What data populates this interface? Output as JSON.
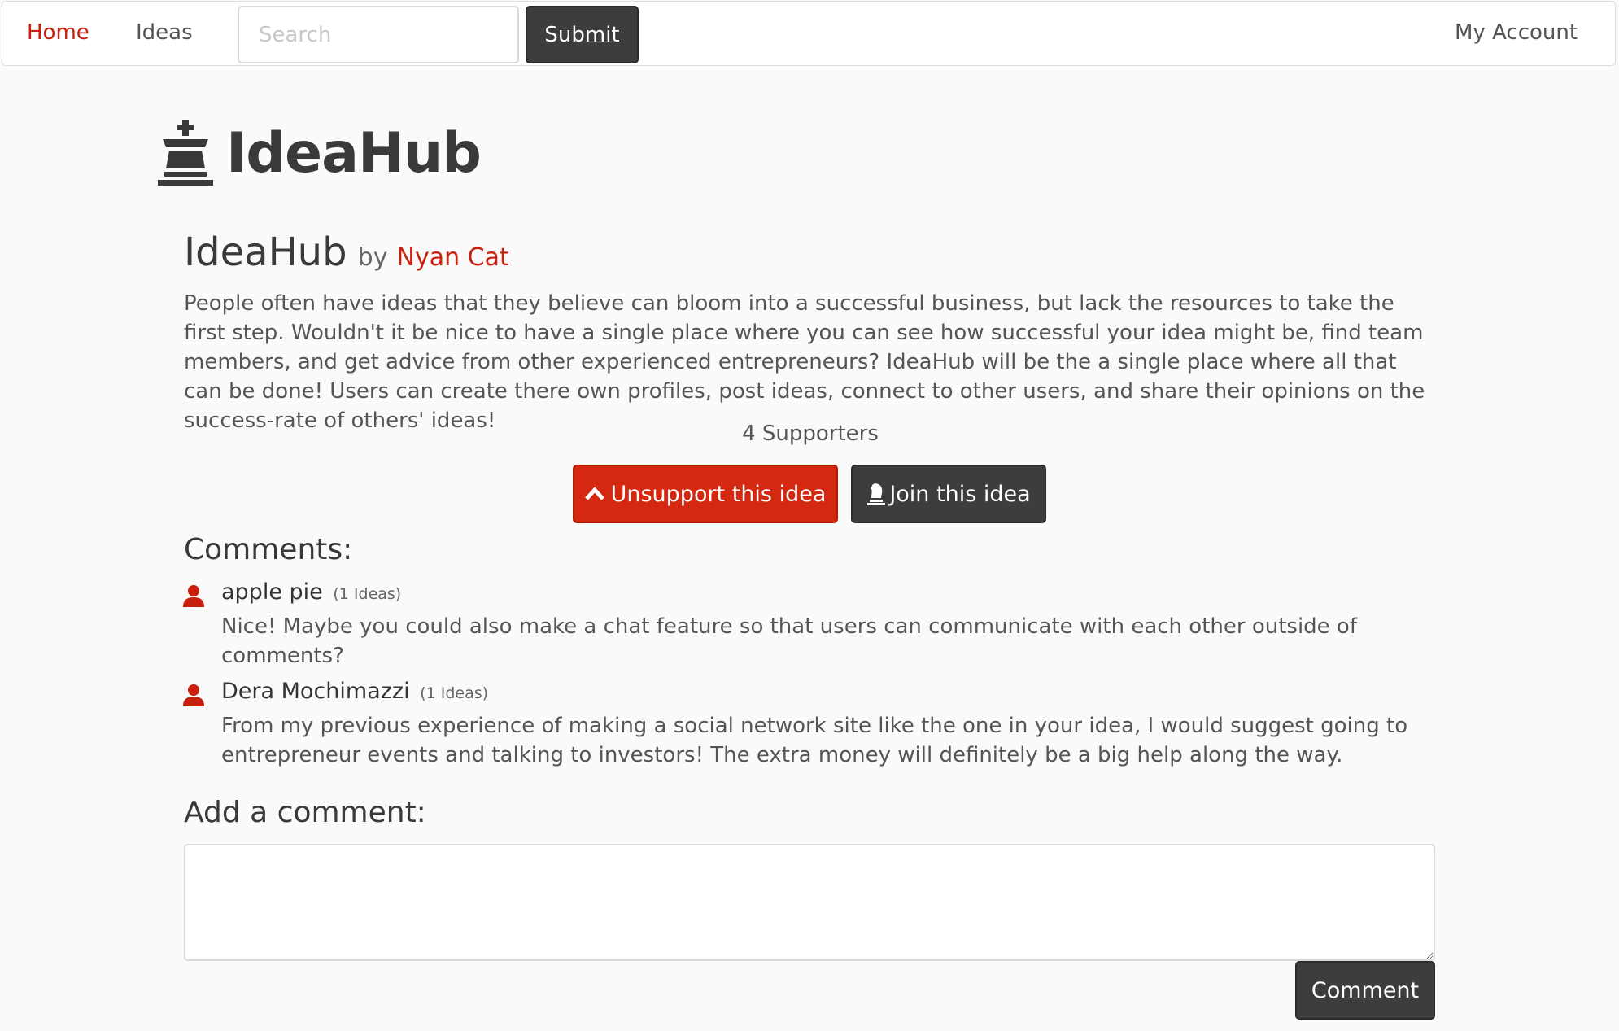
{
  "nav": {
    "home": "Home",
    "ideas": "Ideas",
    "search_placeholder": "Search",
    "submit": "Submit",
    "account": "My Account"
  },
  "brand": {
    "name": "IdeaHub",
    "icon": "chess-king-icon"
  },
  "idea": {
    "title": "IdeaHub",
    "by": "by",
    "author": "Nyan Cat",
    "description": "People often have ideas that they believe can bloom into a successful business, but lack the resources to take the first step. Wouldn't it be nice to have a single place where you can see how successful your idea might be, find team members, and get advice from other experienced entrepreneurs? IdeaHub will be the a single place where all that can be done! Users can create there own profiles, post ideas, connect to other users, and share their opinions on the success-rate of others' ideas!",
    "supporters": "4 Supporters",
    "unsupport_label": "Unsupport this idea",
    "join_label": "Join this idea"
  },
  "comments": {
    "heading": "Comments:",
    "items": [
      {
        "author": "apple pie",
        "ideas_count": "(1 Ideas)",
        "text": "Nice! Maybe you could also make a chat feature so that users can communicate with each other outside of comments?"
      },
      {
        "author": "Dera Mochimazzi",
        "ideas_count": "(1 Ideas)",
        "text": "From my previous experience of making a social network site like the one in your idea, I would suggest going to entrepreneur events and talking to investors! The extra money will definitely be a big help along the way."
      }
    ]
  },
  "add_comment": {
    "heading": "Add a comment:",
    "value": "",
    "button": "Comment"
  },
  "colors": {
    "accent": "#c8200e",
    "button_red": "#d42910",
    "button_dark": "#3d3d3d"
  }
}
